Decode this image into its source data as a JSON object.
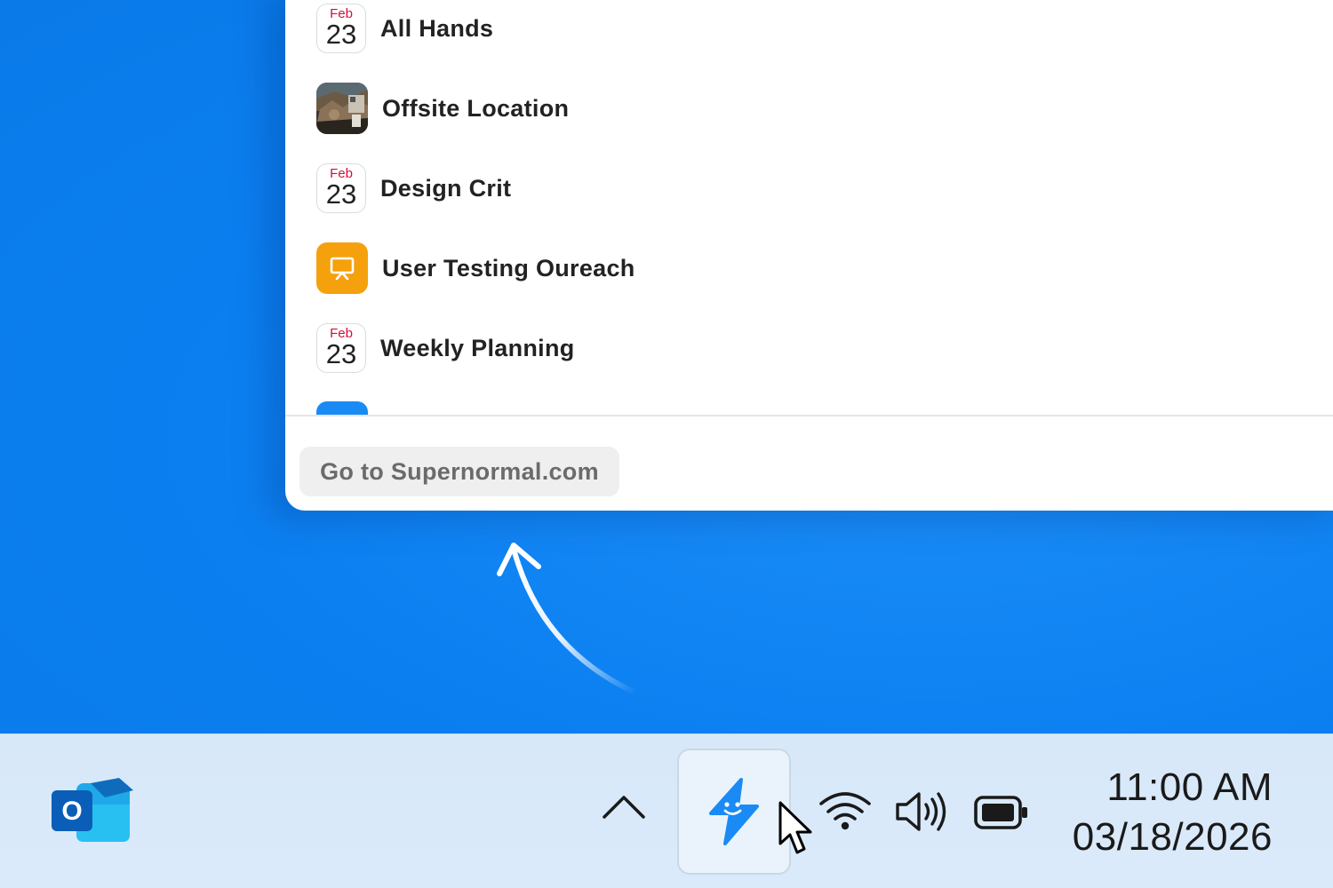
{
  "popup": {
    "items": [
      {
        "label": "All Hands",
        "icon": "calendar-icon",
        "month": "Feb",
        "day": "23"
      },
      {
        "label": "Offsite Location",
        "icon": "photo-thumbnail"
      },
      {
        "label": "Design Crit",
        "icon": "calendar-icon",
        "month": "Feb",
        "day": "23"
      },
      {
        "label": "User Testing Oureach",
        "icon": "presentation-icon"
      },
      {
        "label": "Weekly Planning",
        "icon": "calendar-icon",
        "month": "Feb",
        "day": "23"
      }
    ],
    "footer_button": "Go to Supernormal.com"
  },
  "taskbar": {
    "apps": [
      {
        "name": "Outlook",
        "icon": "outlook-icon",
        "letter": "O"
      }
    ],
    "tray": [
      "chevron-up-icon",
      "supernormal-icon",
      "wifi-icon",
      "volume-icon",
      "battery-icon"
    ],
    "clock": {
      "time": "11:00 AM",
      "date": "03/18/2026"
    }
  },
  "colors": {
    "desktop": "#0b7ff0",
    "taskbar": "#d7e8f8",
    "calendar_month": "#d0103a",
    "presentation_icon": "#f5a10d",
    "supernormal_brand": "#1a8af5"
  }
}
